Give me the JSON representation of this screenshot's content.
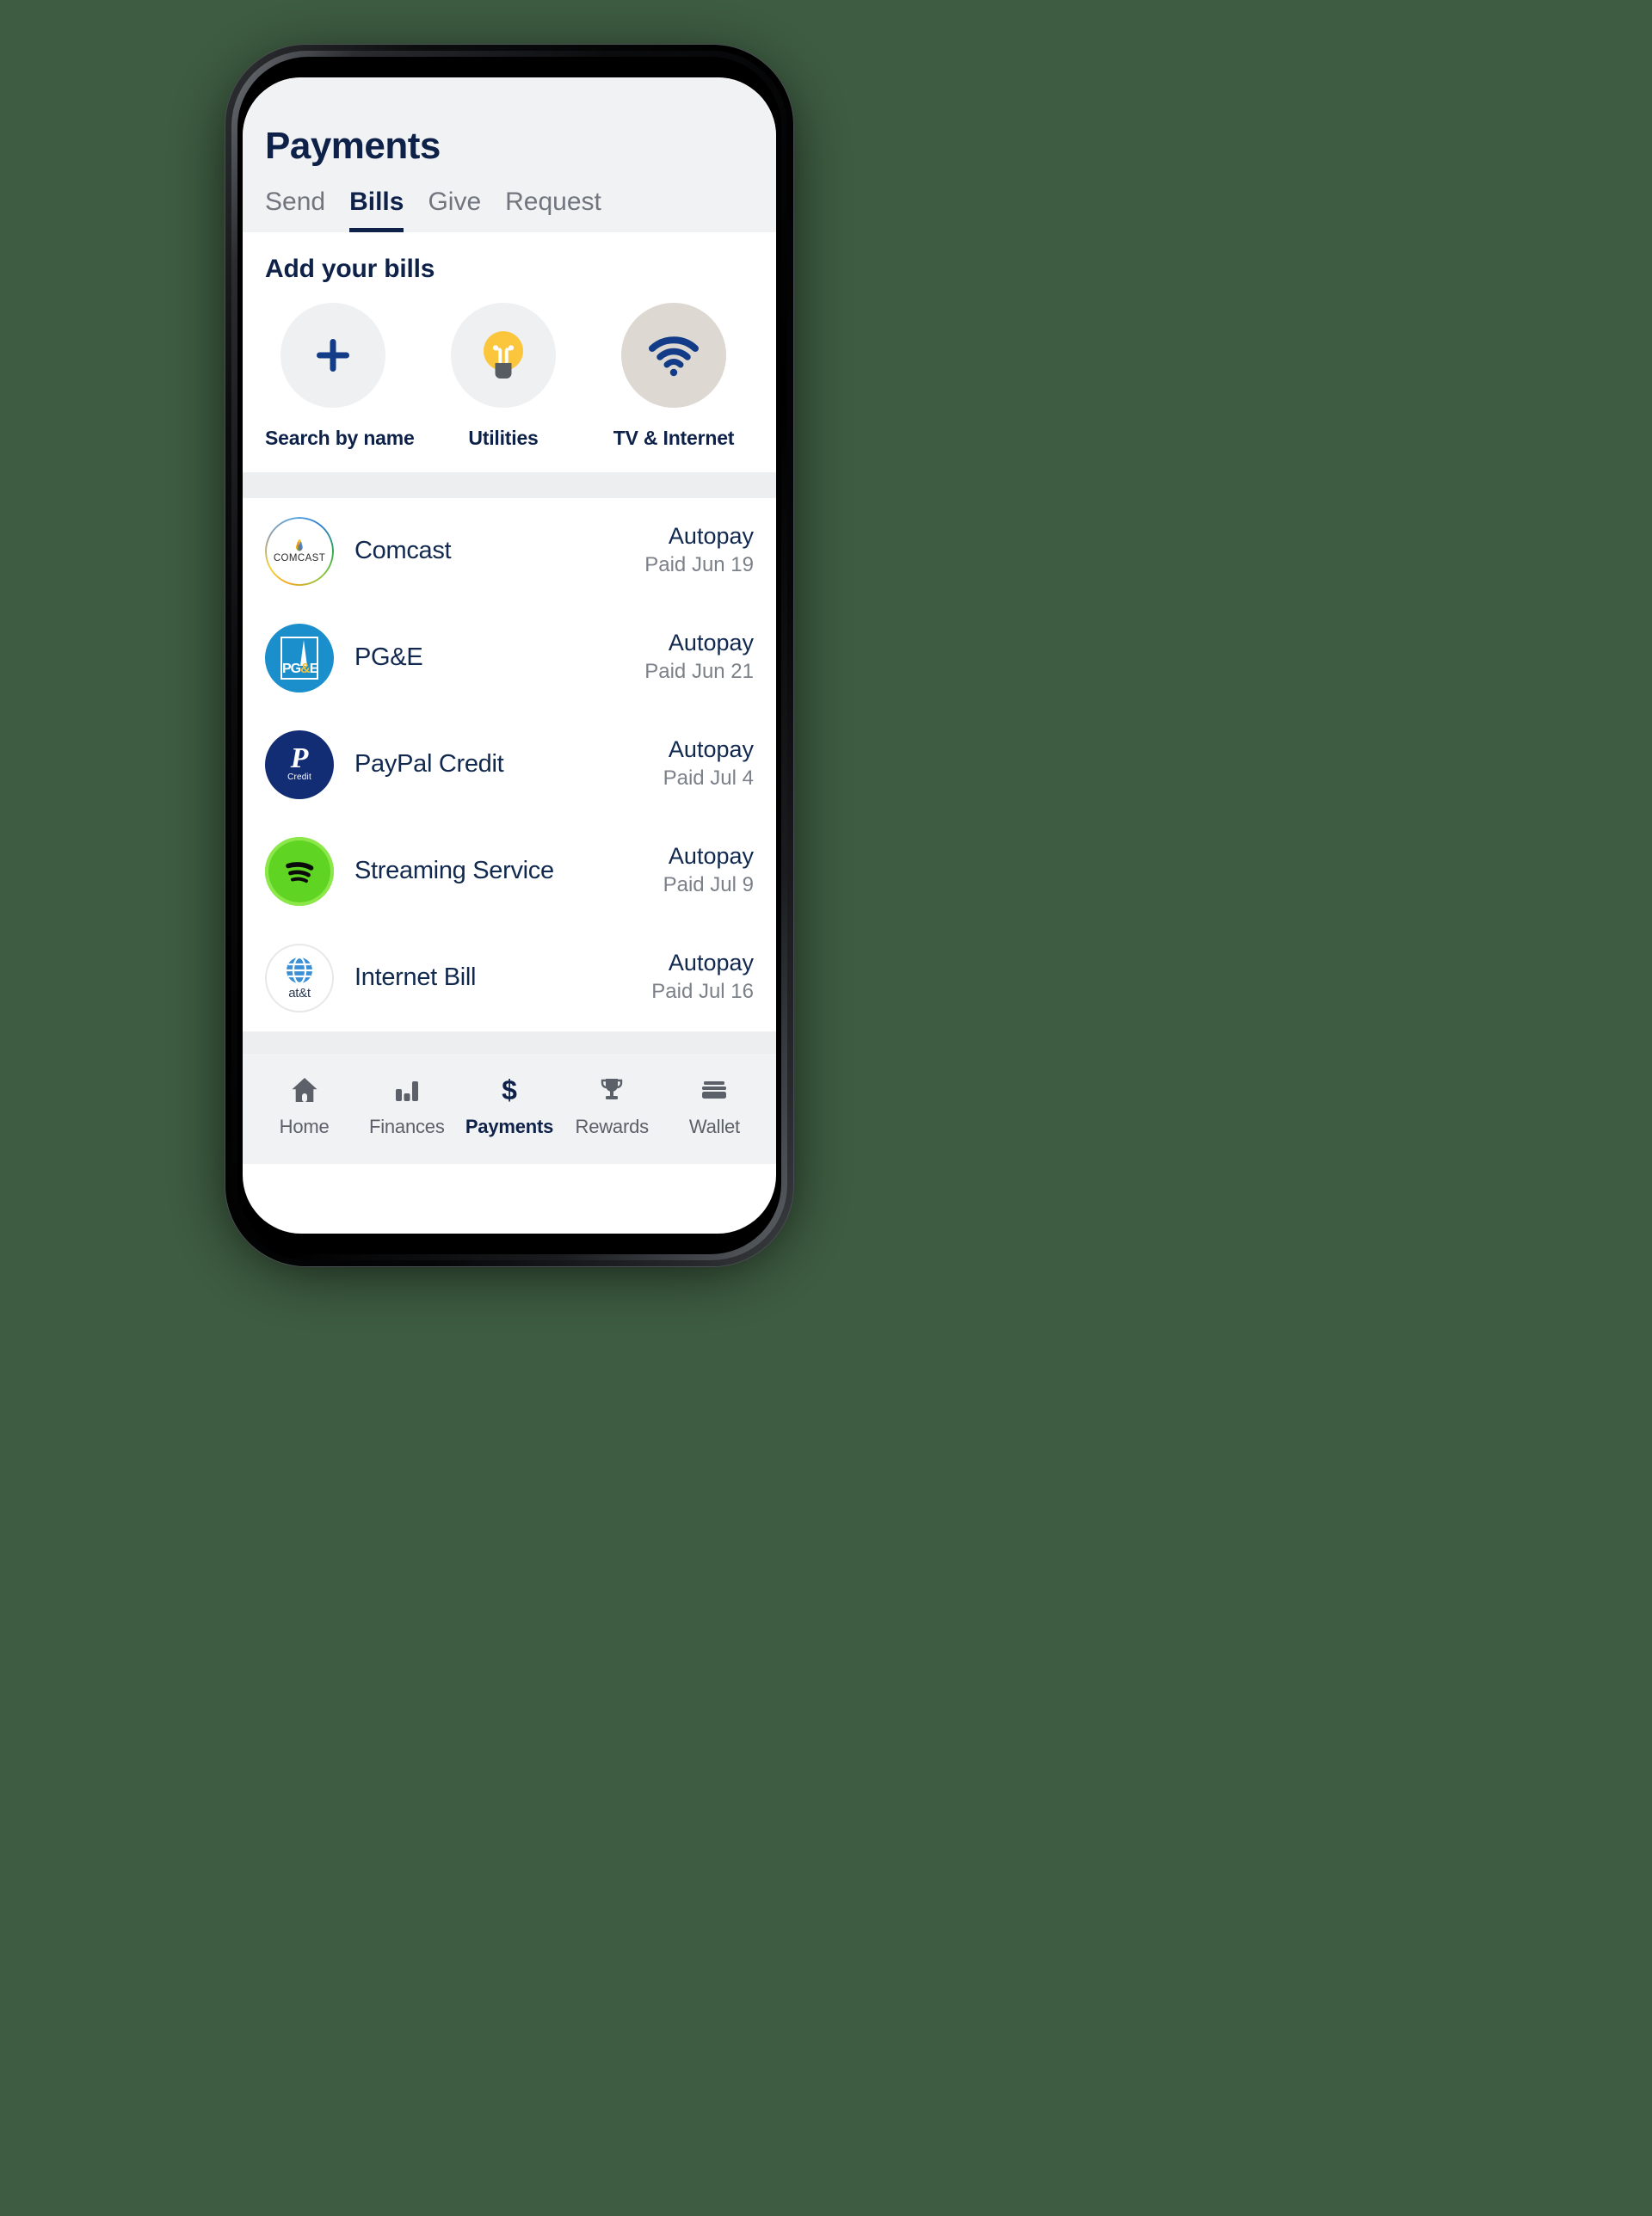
{
  "header": {
    "title": "Payments",
    "tabs": [
      {
        "label": "Send",
        "active": false
      },
      {
        "label": "Bills",
        "active": true
      },
      {
        "label": "Give",
        "active": false
      },
      {
        "label": "Request",
        "active": false
      }
    ]
  },
  "add_bills": {
    "section_title": "Add your bills",
    "categories": [
      {
        "label": "Search by name",
        "icon": "plus-icon",
        "circle": "gray"
      },
      {
        "label": "Utilities",
        "icon": "lightbulb-icon",
        "circle": "gray"
      },
      {
        "label": "TV & Internet",
        "icon": "wifi-icon",
        "circle": "beige"
      }
    ]
  },
  "bills": [
    {
      "name": "Comcast",
      "logo": "comcast-logo",
      "status": "Autopay",
      "paid": "Paid Jun 19"
    },
    {
      "name": "PG&E",
      "logo": "pge-logo",
      "status": "Autopay",
      "paid": "Paid Jun 21"
    },
    {
      "name": "PayPal Credit",
      "logo": "paypal-logo",
      "status": "Autopay",
      "paid": "Paid Jul 4"
    },
    {
      "name": "Streaming Service",
      "logo": "spotify-logo",
      "status": "Autopay",
      "paid": "Paid Jul 9"
    },
    {
      "name": "Internet Bill",
      "logo": "att-logo",
      "status": "Autopay",
      "paid": "Paid Jul 16"
    }
  ],
  "logo_text": {
    "comcast": "COMCAST",
    "pge_left": "PG",
    "pge_amp": "&",
    "pge_right": "E",
    "paypal_mark": "P",
    "paypal_credit": "Credit",
    "att": "at&t"
  },
  "bottom_nav": [
    {
      "label": "Home",
      "icon": "home-icon",
      "active": false
    },
    {
      "label": "Finances",
      "icon": "chart-icon",
      "active": false
    },
    {
      "label": "Payments",
      "icon": "dollar-icon",
      "active": true
    },
    {
      "label": "Rewards",
      "icon": "trophy-icon",
      "active": false
    },
    {
      "label": "Wallet",
      "icon": "wallet-icon",
      "active": false
    }
  ],
  "colors": {
    "navy": "#0e2249",
    "accent_blue": "#123c88",
    "bulb_yellow": "#fbc53c",
    "background": "#3e5c41",
    "muted_gray": "#71767e"
  }
}
